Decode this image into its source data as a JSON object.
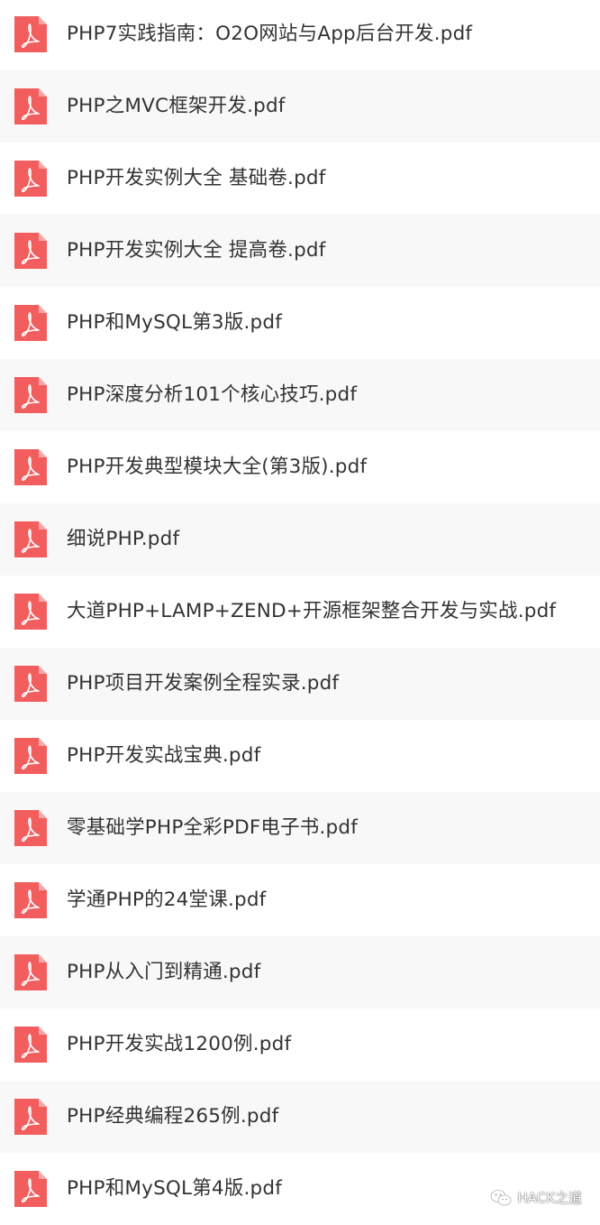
{
  "colors": {
    "pdf_icon": "#f25e5e",
    "row_alt_background": "#f8f8f8",
    "text": "#333333"
  },
  "files": [
    {
      "name": "PHP7实践指南：O2O网站与App后台开发.pdf",
      "icon": "pdf-icon"
    },
    {
      "name": "PHP之MVC框架开发.pdf",
      "icon": "pdf-icon"
    },
    {
      "name": "PHP开发实例大全  基础卷.pdf",
      "icon": "pdf-icon"
    },
    {
      "name": "PHP开发实例大全  提高卷.pdf",
      "icon": "pdf-icon"
    },
    {
      "name": "PHP和MySQL第3版.pdf",
      "icon": "pdf-icon"
    },
    {
      "name": "PHP深度分析101个核心技巧.pdf",
      "icon": "pdf-icon"
    },
    {
      "name": "PHP开发典型模块大全(第3版).pdf",
      "icon": "pdf-icon"
    },
    {
      "name": "细说PHP.pdf",
      "icon": "pdf-icon"
    },
    {
      "name": "大道PHP+LAMP+ZEND+开源框架整合开发与实战.pdf",
      "icon": "pdf-icon"
    },
    {
      "name": "PHP项目开发案例全程实录.pdf",
      "icon": "pdf-icon"
    },
    {
      "name": "PHP开发实战宝典.pdf",
      "icon": "pdf-icon"
    },
    {
      "name": "零基础学PHP全彩PDF电子书.pdf",
      "icon": "pdf-icon"
    },
    {
      "name": "学通PHP的24堂课.pdf",
      "icon": "pdf-icon"
    },
    {
      "name": "PHP从入门到精通.pdf",
      "icon": "pdf-icon"
    },
    {
      "name": "PHP开发实战1200例.pdf",
      "icon": "pdf-icon"
    },
    {
      "name": "PHP经典编程265例.pdf",
      "icon": "pdf-icon"
    },
    {
      "name": "PHP和MySQL第4版.pdf",
      "icon": "pdf-icon"
    }
  ],
  "watermark": {
    "text": "HACK之道",
    "icon": "wechat-icon"
  }
}
